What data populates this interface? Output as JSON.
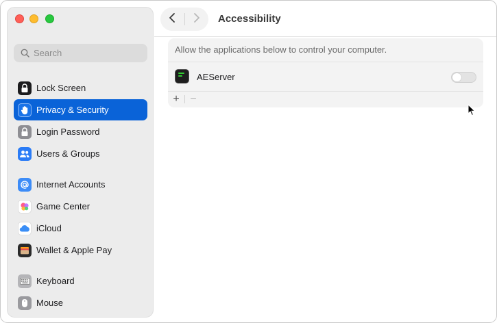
{
  "window": {
    "title": "Accessibility"
  },
  "sidebar": {
    "search_placeholder": "Search",
    "items": [
      {
        "label": "Lock Screen",
        "icon": "lock-icon",
        "color": "#1c1c1e"
      },
      {
        "label": "Privacy & Security",
        "icon": "hand-icon",
        "color": "#1a73e8",
        "active": true
      },
      {
        "label": "Login Password",
        "icon": "lock-icon",
        "color": "#8e8e93"
      },
      {
        "label": "Users & Groups",
        "icon": "users-icon",
        "color": "#2b7cf6"
      },
      {
        "label": "Internet Accounts",
        "icon": "at-icon",
        "color": "#3d8cf7"
      },
      {
        "label": "Game Center",
        "icon": "game-center-icon",
        "color": "#ffffff"
      },
      {
        "label": "iCloud",
        "icon": "cloud-icon",
        "color": "#ffffff"
      },
      {
        "label": "Wallet & Apple Pay",
        "icon": "wallet-icon",
        "color": "#2a2a2a"
      },
      {
        "label": "Keyboard",
        "icon": "keyboard-icon",
        "color": "#b5b5b8"
      },
      {
        "label": "Mouse",
        "icon": "mouse-icon",
        "color": "#9a9a9e"
      }
    ]
  },
  "main": {
    "description": "Allow the applications below to control your computer.",
    "apps": [
      {
        "name": "AEServer",
        "icon": "terminal-app-icon",
        "enabled": false
      }
    ],
    "add_label": "+",
    "remove_label": "−"
  },
  "colors": {
    "accent": "#0a63d8",
    "close": "#ff5f57",
    "minimize": "#febc2e",
    "zoom": "#28c840"
  }
}
